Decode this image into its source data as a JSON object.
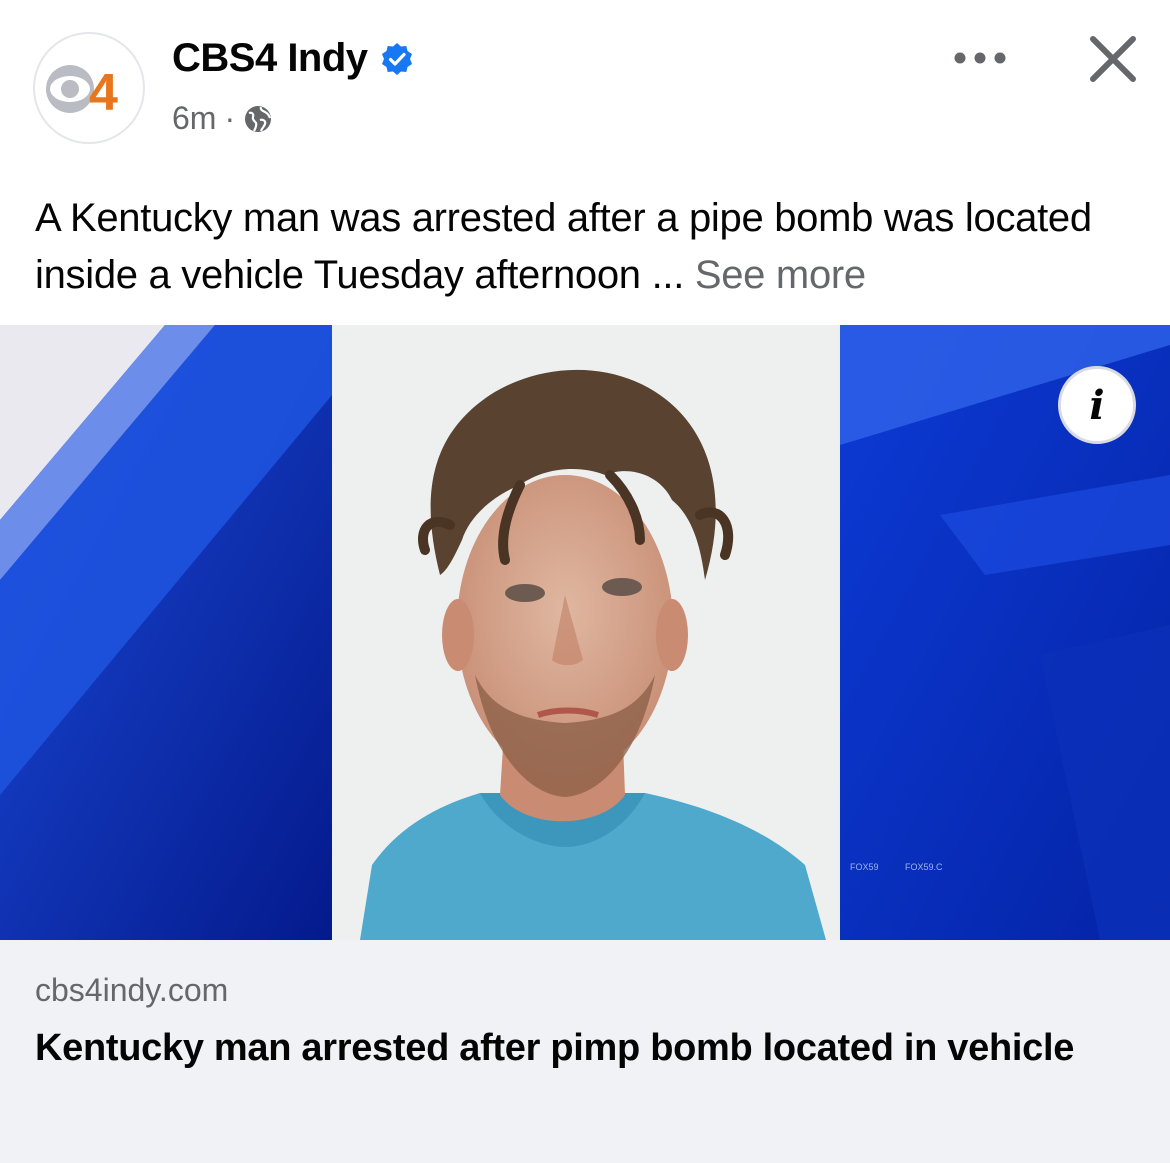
{
  "post": {
    "page_name": "CBS4 Indy",
    "avatar_text": "4",
    "timestamp": "6m",
    "separator": "·",
    "text": "A Kentucky man was arrested after a pipe bomb was located inside a vehicle Tuesday afternoon",
    "ellipsis": " ... ",
    "see_more": "See more",
    "audience_icon": "globe-icon",
    "menu_icon": "more-horizontal-icon",
    "close_icon": "close-icon"
  },
  "link": {
    "domain": "cbs4indy.com",
    "title": "Kentucky man arrested after pimp bomb located in vehicle"
  },
  "media": {
    "info_label": "i",
    "watermarks": [
      "FOX59",
      "FOX59.C"
    ]
  },
  "colors": {
    "background": "#ffffff",
    "verified": "#1877f2",
    "secondary_text": "#65676b",
    "link_box": "#f0f2f5",
    "logo_orange": "#e8761c",
    "media_blue": "#0a2fb0"
  }
}
